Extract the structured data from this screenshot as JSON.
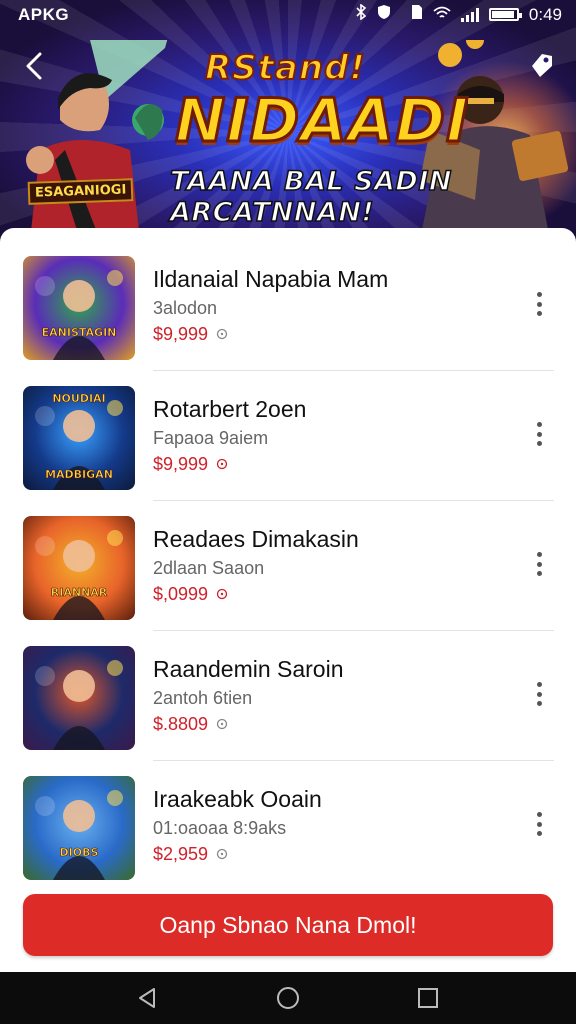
{
  "status_bar": {
    "left_label": "APKG",
    "time": "0:49",
    "battery_level": 0.9
  },
  "banner": {
    "logo_top": "RStand!",
    "logo_main": "NIDAADI",
    "tagline": "TAANA BAL SADIN ARCATNNAN!",
    "emblem_text": "ESAGANIOGI",
    "back_icon": "chevron-left-icon",
    "menu_icon": "tag-icon"
  },
  "games": [
    {
      "title": "Ildanaial Napabia Mam",
      "subtitle": "3alodon",
      "price": "$9,999",
      "info_icon": "info-icon",
      "thumb_label": "EANISTAGIN",
      "colors": [
        "#5a2db8",
        "#2fa84a",
        "#e0a020"
      ]
    },
    {
      "title": "Rotarbert 2oen",
      "subtitle": "Fapaoa 9aiem",
      "price": "$9,999",
      "info_icon": "info-icon",
      "thumb_label": "NOUDIAI",
      "thumb_label2": "MADBIGAN",
      "colors": [
        "#143a8a",
        "#39a0ff",
        "#0c1a3a"
      ]
    },
    {
      "title": "Readaes Dimakasin",
      "subtitle": "2dlaan Saaon",
      "price": "$,0999",
      "info_icon": "info-icon",
      "thumb_label": "RIANNAR",
      "colors": [
        "#e8642a",
        "#f4b02a",
        "#5a1e0c"
      ]
    },
    {
      "title": "Raandemin Saroin",
      "subtitle": "2antoh 6tien",
      "price": "$.8809",
      "info_icon": "info-icon",
      "thumb_label": "",
      "colors": [
        "#1e2a6a",
        "#e0582a",
        "#3a1a4a"
      ]
    },
    {
      "title": "Iraakeabk Ooain",
      "subtitle": "01:oaoaa 8:9aks",
      "price": "$2,959",
      "info_icon": "info-icon",
      "thumb_label": "DIOBS",
      "colors": [
        "#2a6ac8",
        "#68b0f0",
        "#3a6a2a"
      ]
    }
  ],
  "more_icon": "more-vertical-icon",
  "cta_label": "Oanp Sbnao Nana Dmol!",
  "nav": {
    "back": "nav-back-icon",
    "home": "nav-home-icon",
    "recents": "nav-recents-icon"
  }
}
